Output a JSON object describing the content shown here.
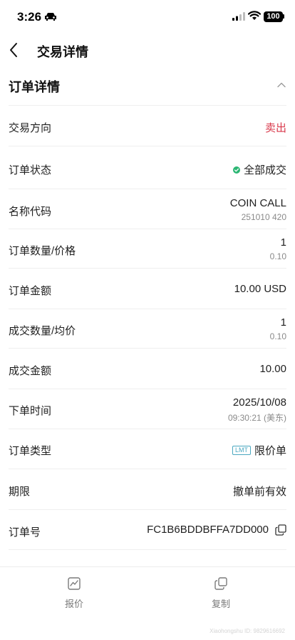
{
  "status_bar": {
    "time": "3:26",
    "battery": "100"
  },
  "nav": {
    "title": "交易详情"
  },
  "section": {
    "title": "订单详情"
  },
  "rows": [
    {
      "label": "交易方向",
      "value": "卖出"
    },
    {
      "label": "订单状态",
      "value": "全部成交"
    },
    {
      "label": "名称代码",
      "value": "COIN CALL",
      "sub": "251010 420"
    },
    {
      "label": "订单数量/价格",
      "value": "1",
      "sub": "0.10"
    },
    {
      "label": "订单金额",
      "value": "10.00 USD"
    },
    {
      "label": "成交数量/均价",
      "value": "1",
      "sub": "0.10"
    },
    {
      "label": "成交金额",
      "value": "10.00"
    },
    {
      "label": "下单时间",
      "value": "2025/10/08",
      "sub": "09:30:21 (美东)"
    },
    {
      "label": "订单类型",
      "badge": "LMT",
      "value": "限价单"
    },
    {
      "label": "期限",
      "value": "撤单前有效"
    },
    {
      "label": "订单号",
      "value": "FC1B6BDDBFFA7DD000"
    }
  ],
  "bottom_tabs": [
    {
      "label": "报价",
      "icon": "chart-icon"
    },
    {
      "label": "复制",
      "icon": "copy-icon"
    }
  ],
  "watermark": "Xiaohongshu ID: 9829616692",
  "colors": {
    "sell": "#d93a4c",
    "success": "#2bb673",
    "badge": "#4aa7c0"
  }
}
